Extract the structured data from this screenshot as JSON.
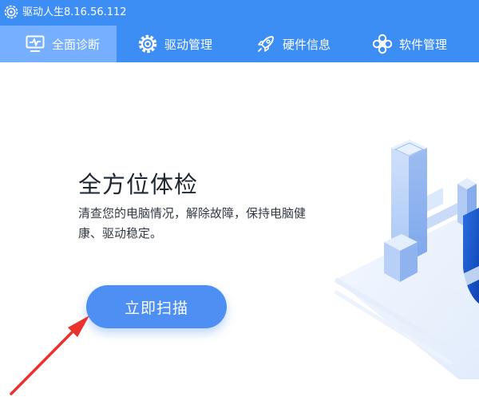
{
  "window": {
    "title": "驱动人生8.16.56.112",
    "logo_icon": "gear-logo-icon"
  },
  "nav": {
    "tabs": [
      {
        "label": "全面诊断",
        "icon": "monitor-pulse-icon",
        "active": true
      },
      {
        "label": "驱动管理",
        "icon": "gear-icon",
        "active": false
      },
      {
        "label": "硬件信息",
        "icon": "rocket-icon",
        "active": false
      },
      {
        "label": "软件管理",
        "icon": "flower-icon",
        "active": false
      }
    ]
  },
  "main": {
    "headline": "全方位体检",
    "description": "清查您的电脑情况，解除故障，保持电脑健康、驱动稳定。",
    "scan_button": "立即扫描"
  },
  "colors": {
    "primary": "#3d8ef4",
    "active_tab": "#77afff",
    "button": "#4e8ff4",
    "annotation_arrow": "#e8322b"
  }
}
